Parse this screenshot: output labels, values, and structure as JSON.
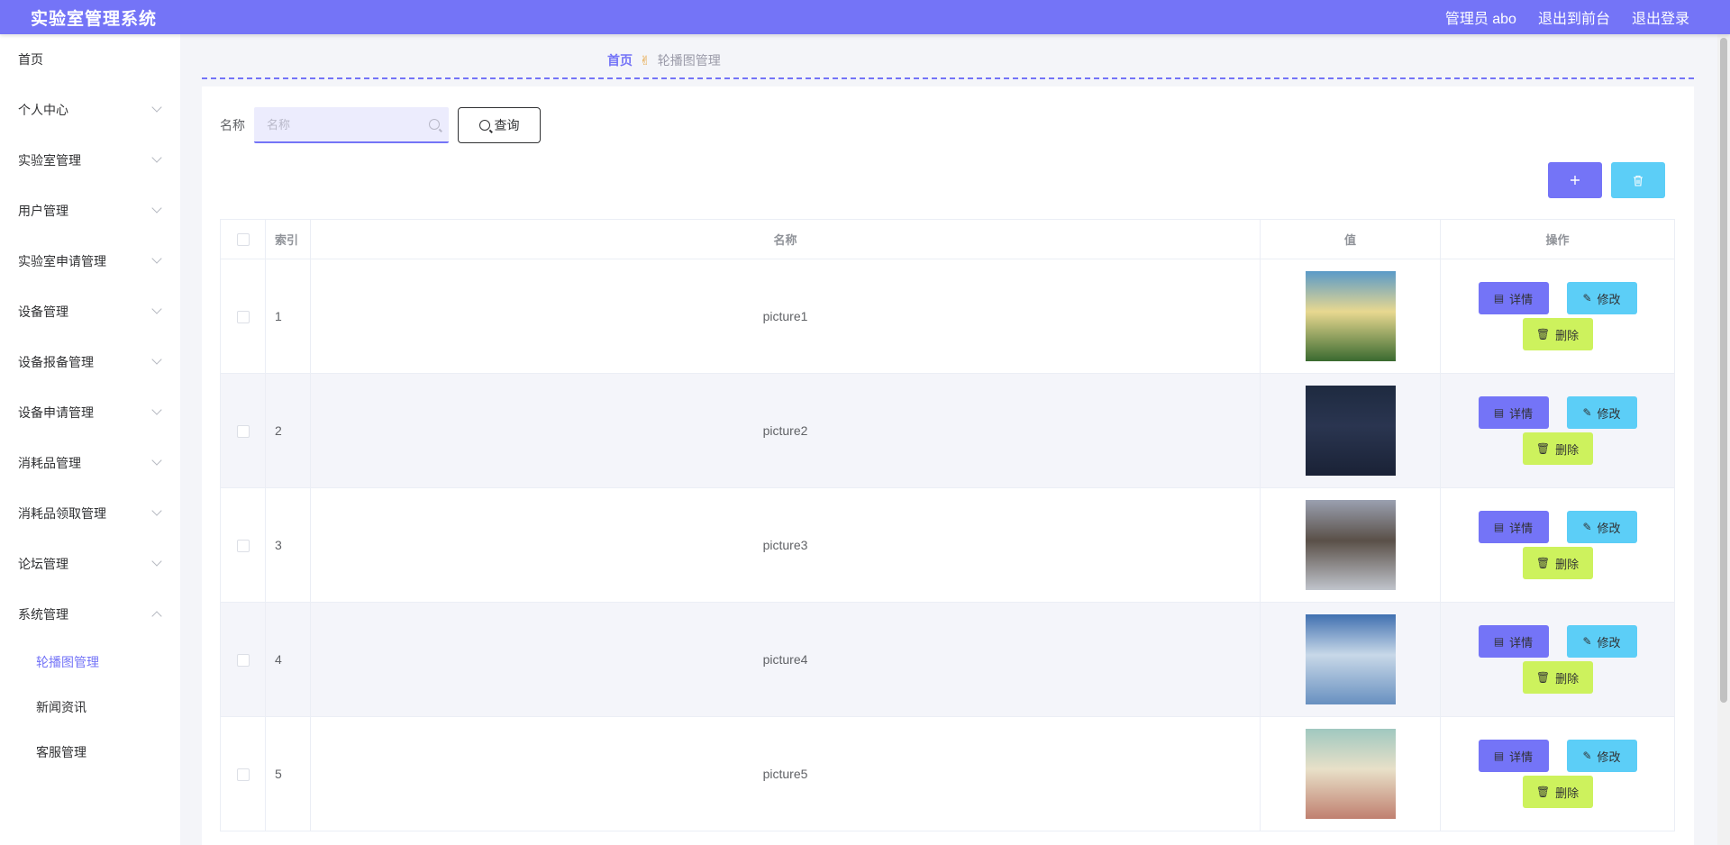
{
  "header": {
    "app_title": "实验室管理系统",
    "user_label": "管理员 abo",
    "front_link": "退出到前台",
    "logout_link": "退出登录"
  },
  "sidebar": {
    "items": [
      {
        "label": "首页",
        "has_chevron": false
      },
      {
        "label": "个人中心",
        "has_chevron": true
      },
      {
        "label": "实验室管理",
        "has_chevron": true
      },
      {
        "label": "用户管理",
        "has_chevron": true
      },
      {
        "label": "实验室申请管理",
        "has_chevron": true
      },
      {
        "label": "设备管理",
        "has_chevron": true
      },
      {
        "label": "设备报备管理",
        "has_chevron": true
      },
      {
        "label": "设备申请管理",
        "has_chevron": true
      },
      {
        "label": "消耗品管理",
        "has_chevron": true
      },
      {
        "label": "消耗品领取管理",
        "has_chevron": true
      },
      {
        "label": "论坛管理",
        "has_chevron": true
      },
      {
        "label": "系统管理",
        "has_chevron": true,
        "expanded": true
      }
    ],
    "sub_items": [
      {
        "label": "轮播图管理",
        "active": true
      },
      {
        "label": "新闻资讯",
        "active": false
      },
      {
        "label": "客服管理",
        "active": false
      }
    ]
  },
  "breadcrumb": {
    "home": "首页",
    "current": "轮播图管理"
  },
  "search": {
    "label": "名称",
    "placeholder": "名称",
    "value": "",
    "button_label": "查询"
  },
  "toolbar": {
    "add_icon": "plus-icon",
    "delete_icon": "trash-icon"
  },
  "table": {
    "headers": {
      "index": "索引",
      "name": "名称",
      "value": "值",
      "ops": "操作"
    },
    "rows": [
      {
        "index": "1",
        "name": "picture1",
        "image_colors": [
          "#5a9ac8",
          "#e8d890",
          "#3a6a30"
        ]
      },
      {
        "index": "2",
        "name": "picture2",
        "image_colors": [
          "#1e2a40",
          "#2a3550",
          "#1a2236"
        ]
      },
      {
        "index": "3",
        "name": "picture3",
        "image_colors": [
          "#9aa0b0",
          "#5a5048",
          "#c0c4cc"
        ]
      },
      {
        "index": "4",
        "name": "picture4",
        "image_colors": [
          "#4070b0",
          "#c8d8e8",
          "#6890c0"
        ]
      },
      {
        "index": "5",
        "name": "picture5",
        "image_colors": [
          "#a0c8c0",
          "#e8e0c8",
          "#c08070"
        ]
      }
    ],
    "op_labels": {
      "detail": "详情",
      "edit": "修改",
      "remove": "删除"
    }
  },
  "colors": {
    "primary": "#7474f7",
    "info": "#5ccef7",
    "lime": "#cdf25d"
  }
}
